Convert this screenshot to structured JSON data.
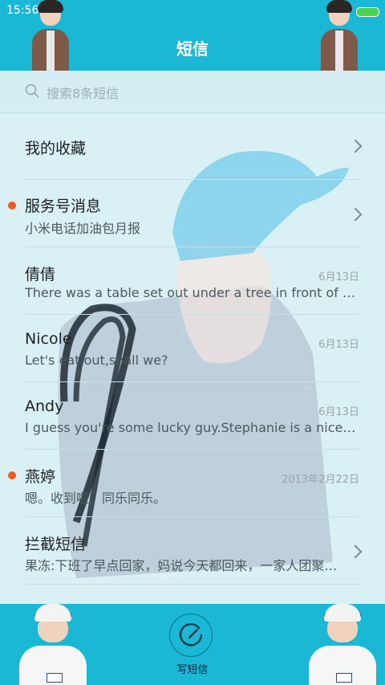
{
  "status_bar": {
    "time": "15:56"
  },
  "header": {
    "title": "短信"
  },
  "search": {
    "placeholder": "搜索8条短信"
  },
  "rows": [
    {
      "title": "我的收藏",
      "subtitle": "",
      "date": "",
      "unread": false,
      "chevron": true
    },
    {
      "title": "服务号消息",
      "subtitle": "小米电话加油包月报",
      "date": "",
      "unread": true,
      "chevron": true
    },
    {
      "title": "倩倩",
      "subtitle": "There was a table set out under a tree in front of the ho…",
      "date": "6月13日",
      "unread": false,
      "chevron": false
    },
    {
      "title": "Nicole",
      "subtitle": "Let's eat out,shall we?",
      "date": "6月13日",
      "unread": false,
      "chevron": false
    },
    {
      "title": "Andy",
      "subtitle": "I guess you're some lucky guy.Stephanie is a nice girl.",
      "date": "6月13日",
      "unread": false,
      "chevron": false
    },
    {
      "title": "燕婷",
      "subtitle": "嗯。收到啦。同乐同乐。",
      "date": "2013年2月22日",
      "unread": true,
      "chevron": false
    },
    {
      "title": "拦截短信",
      "subtitle": "果冻:下班了早点回家，妈说今天都回来，一家人团聚过…",
      "date": "",
      "unread": false,
      "chevron": true
    }
  ],
  "footer": {
    "compose_label": "写短信"
  },
  "colors": {
    "header_bg": "#1bb8d6",
    "list_bg": "#d9f0f5",
    "unread_dot": "#f05a22",
    "battery": "#4cd24c"
  }
}
